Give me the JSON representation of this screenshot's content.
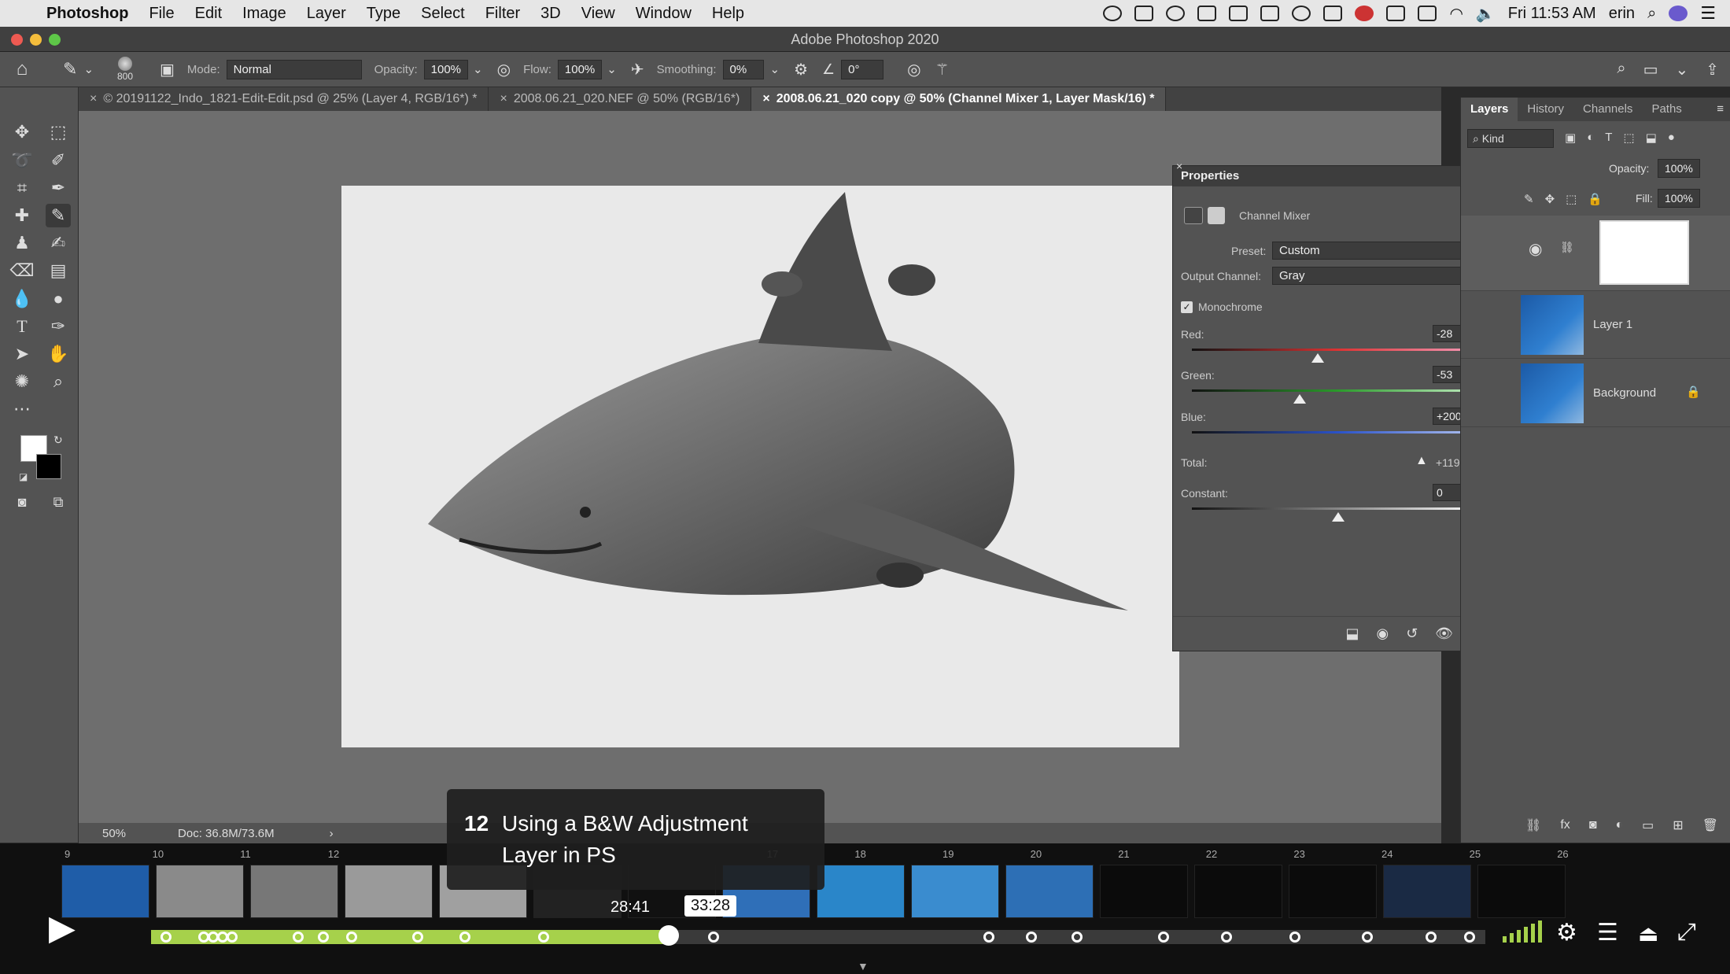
{
  "menubar": {
    "app_name": "Photoshop",
    "items": [
      "File",
      "Edit",
      "Image",
      "Layer",
      "Type",
      "Select",
      "Filter",
      "3D",
      "View",
      "Window",
      "Help"
    ],
    "clock": "Fri 11:53 AM",
    "user": "erin"
  },
  "window": {
    "title": "Adobe Photoshop 2020"
  },
  "options_bar": {
    "brush_size": "800",
    "mode_label": "Mode:",
    "mode_value": "Normal",
    "opacity_label": "Opacity:",
    "opacity_value": "100%",
    "flow_label": "Flow:",
    "flow_value": "100%",
    "smoothing_label": "Smoothing:",
    "smoothing_value": "0%",
    "angle_value": "0°"
  },
  "doc_tabs": [
    {
      "label": "© 20191122_Indo_1821-Edit-Edit.psd @ 25% (Layer 4, RGB/16*) *",
      "active": false
    },
    {
      "label": "2008.06.21_020.NEF @ 50% (RGB/16*)",
      "active": false
    },
    {
      "label": "2008.06.21_020 copy @ 50% (Channel Mixer 1, Layer Mask/16) *",
      "active": true
    }
  ],
  "status_bar": {
    "zoom": "50%",
    "doc_size": "Doc: 36.8M/73.6M"
  },
  "properties": {
    "title": "Properties",
    "adjustment": "Channel Mixer",
    "preset_label": "Preset:",
    "preset_value": "Custom",
    "output_label": "Output Channel:",
    "output_value": "Gray",
    "monochrome_label": "Monochrome",
    "monochrome_checked": true,
    "red_label": "Red:",
    "red_value": "-28",
    "green_label": "Green:",
    "green_value": "-53",
    "blue_label": "Blue:",
    "blue_value": "+200",
    "total_label": "Total:",
    "total_value": "+119",
    "constant_label": "Constant:",
    "constant_value": "0",
    "pct": "%"
  },
  "layers_panel": {
    "tabs": [
      "Layers",
      "History",
      "Channels",
      "Paths"
    ],
    "filter_kind": "Kind",
    "opacity_label": "Opacity:",
    "opacity_value": "100%",
    "fill_label": "Fill:",
    "fill_value": "100%",
    "layers": [
      "Layer 1",
      "Background"
    ]
  },
  "video": {
    "chapter_number": "12",
    "chapter_title_line1": "Using a B&W Adjustment",
    "chapter_title_line2": "Layer in PS",
    "hover_time": "28:41",
    "current_time": "33:28",
    "progress_fraction": 0.388,
    "chapter_labels": [
      "9",
      "10",
      "11",
      "12",
      "17",
      "18",
      "19",
      "20",
      "21",
      "22",
      "23",
      "24",
      "25",
      "26"
    ]
  },
  "colors": {
    "accent_green": "#a6d14b",
    "ps_panel": "#535353",
    "canvas_bg": "#6e6e6e"
  }
}
